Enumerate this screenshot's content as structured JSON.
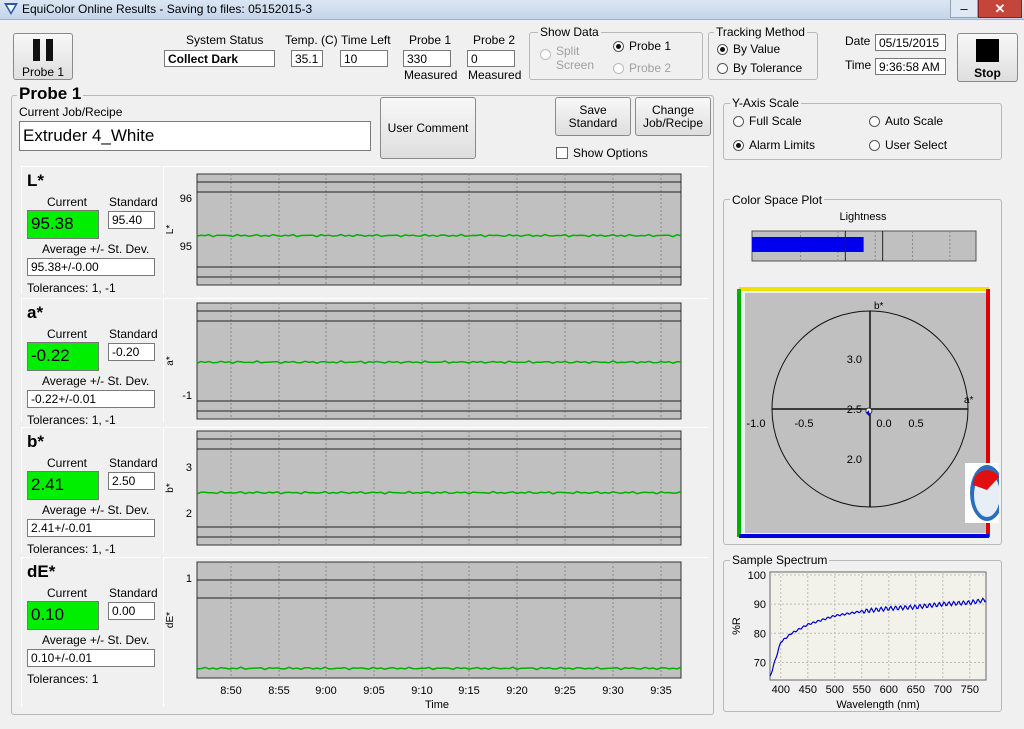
{
  "window": {
    "title": "EquiColor Online Results - Saving to files: 05152015-3",
    "minimize": "–",
    "close": "✕"
  },
  "toolbar": {
    "probe_btn_label": "Probe 1",
    "stop_label": "Stop"
  },
  "status": {
    "system_status_label": "System Status",
    "system_status_value": "Collect Dark",
    "temp_label": "Temp. (C)",
    "temp_value": "35.1",
    "time_left_label": "Time Left",
    "time_left_value": "10",
    "probe1_label": "Probe 1",
    "probe1_value": "330",
    "probe1_sub": "Measured",
    "probe2_label": "Probe 2",
    "probe2_value": "0",
    "probe2_sub": "Measured"
  },
  "show_data": {
    "title": "Show Data",
    "split_screen": "Split Screen",
    "probe1": "Probe 1",
    "probe2": "Probe 2",
    "selected": "Probe 1"
  },
  "tracking": {
    "title": "Tracking Method",
    "by_value": "By Value",
    "by_tolerance": "By Tolerance",
    "selected": "By Value"
  },
  "datetime": {
    "date_label": "Date",
    "date_value": "05/15/2015",
    "time_label": "Time",
    "time_value": "9:36:58 AM"
  },
  "probe_header": "Probe 1",
  "job": {
    "label": "Current Job/Recipe",
    "value": "Extruder 4_White",
    "user_comment": "User Comment",
    "save_standard": "Save Standard",
    "change_job": "Change Job/Recipe",
    "show_options": "Show Options"
  },
  "yaxis": {
    "title": "Y-Axis Scale",
    "full_scale": "Full Scale",
    "auto_scale": "Auto Scale",
    "alarm_limits": "Alarm Limits",
    "user_select": "User Select",
    "selected": "Alarm Limits"
  },
  "metrics": [
    {
      "name": "L*",
      "current_label": "Current",
      "standard_label": "Standard",
      "current": "95.38",
      "standard": "95.40",
      "avg_label": "Average +/- St. Dev.",
      "avg": "95.38+/-0.00",
      "tolerances": "Tolerances:  1, -1",
      "axis_label": "L*"
    },
    {
      "name": "a*",
      "current_label": "Current",
      "standard_label": "Standard",
      "current": "-0.22",
      "standard": "-0.20",
      "avg_label": "Average +/- St. Dev.",
      "avg": "-0.22+/-0.01",
      "tolerances": "Tolerances:  1, -1",
      "axis_label": "a*"
    },
    {
      "name": "b*",
      "current_label": "Current",
      "standard_label": "Standard",
      "current": "2.41",
      "standard": "2.50",
      "avg_label": "Average +/- St. Dev.",
      "avg": "2.41+/-0.01",
      "tolerances": "Tolerances:  1, -1",
      "axis_label": "b*"
    },
    {
      "name": "dE*",
      "current_label": "Current",
      "standard_label": "Standard",
      "current": "0.10",
      "standard": "0.00",
      "avg_label": "Average +/- St. Dev.",
      "avg": "0.10+/-0.01",
      "tolerances": "Tolerances:  1",
      "axis_label": "dE*"
    }
  ],
  "time_axis": {
    "ticks": [
      "8:50",
      "8:55",
      "9:00",
      "9:05",
      "9:10",
      "9:15",
      "9:20",
      "9:25",
      "9:30",
      "9:35"
    ],
    "label": "Time"
  },
  "chart_data": [
    {
      "type": "line",
      "ylabel": "L*",
      "yticks": [
        "96",
        "95"
      ],
      "ylim": [
        94.4,
        96.6
      ],
      "series": [
        {
          "values": [
            95.38
          ]
        }
      ],
      "color": "#00b000"
    },
    {
      "type": "line",
      "ylabel": "a*",
      "yticks": [
        "-1"
      ],
      "ylim": [
        -1.2,
        0.8
      ],
      "series": [
        {
          "values": [
            -0.22
          ]
        }
      ],
      "color": "#00b000"
    },
    {
      "type": "line",
      "ylabel": "b*",
      "yticks": [
        "3",
        "2"
      ],
      "ylim": [
        1.4,
        3.6
      ],
      "series": [
        {
          "values": [
            2.41
          ]
        }
      ],
      "color": "#00b000"
    },
    {
      "type": "line",
      "ylabel": "dE*",
      "yticks": [
        "1"
      ],
      "ylim": [
        0,
        1.2
      ],
      "series": [
        {
          "values": [
            0.1
          ]
        }
      ],
      "color": "#00b000"
    },
    {
      "type": "bar",
      "title": "Lightness",
      "ticks": [
        "90",
        "92",
        "94",
        "96",
        "98",
        "100"
      ],
      "xlim": [
        89.4,
        101.4
      ],
      "value": 95.38,
      "standard": 95.4,
      "limits": [
        94.4,
        96.4
      ],
      "color": "#0000ee"
    },
    {
      "type": "scatter",
      "title": "Color Space Plot",
      "xlabel": "a*",
      "ylabel": "b*",
      "xticks": [
        "-1.0",
        "-0.5",
        "0.0",
        "0.5"
      ],
      "yticks": [
        "3.0",
        "2.5",
        "2.0"
      ],
      "point": {
        "a": -0.22,
        "b": 2.41
      }
    },
    {
      "type": "line",
      "title": "Sample Spectrum",
      "xlabel": "Wavelength (nm)",
      "ylabel": "%R",
      "xticks": [
        "400",
        "450",
        "500",
        "550",
        "600",
        "650",
        "700",
        "750"
      ],
      "yticks": [
        "100",
        "90",
        "80",
        "70"
      ],
      "xlim": [
        380,
        780
      ],
      "ylim": [
        64,
        101
      ],
      "x": [
        380,
        400,
        420,
        450,
        500,
        550,
        600,
        650,
        700,
        750,
        780
      ],
      "series": [
        {
          "values": [
            65,
            77,
            80,
            83,
            86,
            87.5,
            88.5,
            89,
            90,
            90.5,
            91.5
          ]
        }
      ],
      "color": "#0000cc"
    }
  ],
  "colorspace": {
    "title": "Color Space Plot",
    "b_label": "b*",
    "a_label": "a*"
  },
  "spectrum": {
    "title": "Sample Spectrum"
  },
  "colors": {
    "green": "#00ee00",
    "plot_bg": "#c0c0c0",
    "line": "#00b000"
  }
}
